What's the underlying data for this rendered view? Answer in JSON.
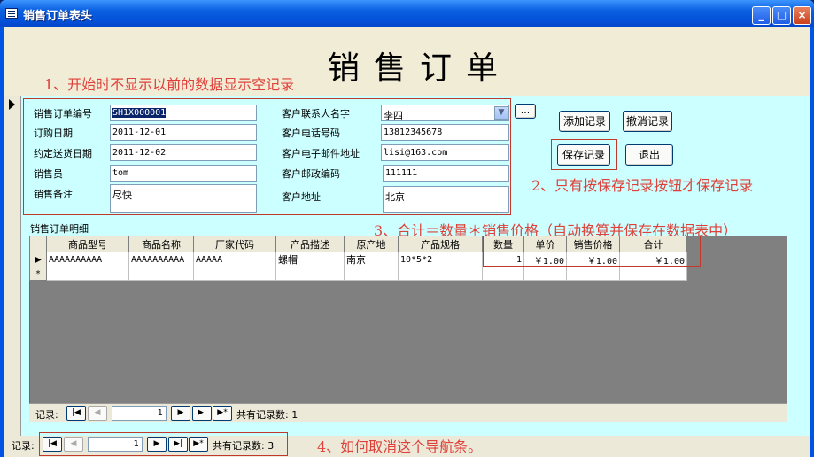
{
  "window": {
    "title": "销售订单表头",
    "minimize": "_",
    "maximize": "□",
    "close": "×"
  },
  "form": {
    "title": "销售订单"
  },
  "annotations": {
    "note1": "1、开始时不显示以前的数据显示空记录",
    "note2": "2、只有按保存记录按钮才保存记录",
    "note3": "3、合计＝数量＊销售价格（自动换算并保存在数据表中）",
    "note4": "4、如何取消这个导航条。"
  },
  "fields": {
    "order_no_label": "销售订单编号",
    "order_no_value": "SH1X000001",
    "order_date_label": "订购日期",
    "order_date_value": "2011-12-01",
    "delivery_date_label": "约定送货日期",
    "delivery_date_value": "2011-12-02",
    "salesperson_label": "销售员",
    "salesperson_value": "tom",
    "remarks_label": "销售备注",
    "remarks_value": "尽快",
    "contact_label": "客户联系人名字",
    "contact_value": "李四",
    "phone_label": "客户电话号码",
    "phone_value": "13812345678",
    "email_label": "客户电子邮件地址",
    "email_value": "lisi@163.com",
    "zip_label": "客户邮政编码",
    "zip_value": "111111",
    "address_label": "客户地址",
    "address_value": "北京"
  },
  "buttons": {
    "ellipsis": "...",
    "add": "添加记录",
    "undo": "撤消记录",
    "save": "保存记录",
    "exit": "退出"
  },
  "subform": {
    "label": "销售订单明细",
    "columns": [
      "商品型号",
      "商品名称",
      "厂家代码",
      "产品描述",
      "原产地",
      "产品规格",
      "数量",
      "单价",
      "销售价格",
      "合计"
    ],
    "row": {
      "model": "AAAAAAAAAA",
      "name": "AAAAAAAAAA",
      "vendor": "AAAAA",
      "desc": "螺帽",
      "origin": "南京",
      "spec": "10*5*2",
      "qty": "1",
      "unit_price": "￥1.00",
      "sale_price": "￥1.00",
      "total": "￥1.00"
    },
    "new_row_marker": "*"
  },
  "subnav": {
    "label": "记录:",
    "current": "1",
    "total_label": "共有记录数: 1"
  },
  "mainnav": {
    "label": "记录:",
    "current": "1",
    "total_label": "共有记录数: 3"
  },
  "colors": {
    "detail_bg": "#ccffff",
    "annotation_red": "#e0403a",
    "titlebar_blue": "#0054e3"
  }
}
